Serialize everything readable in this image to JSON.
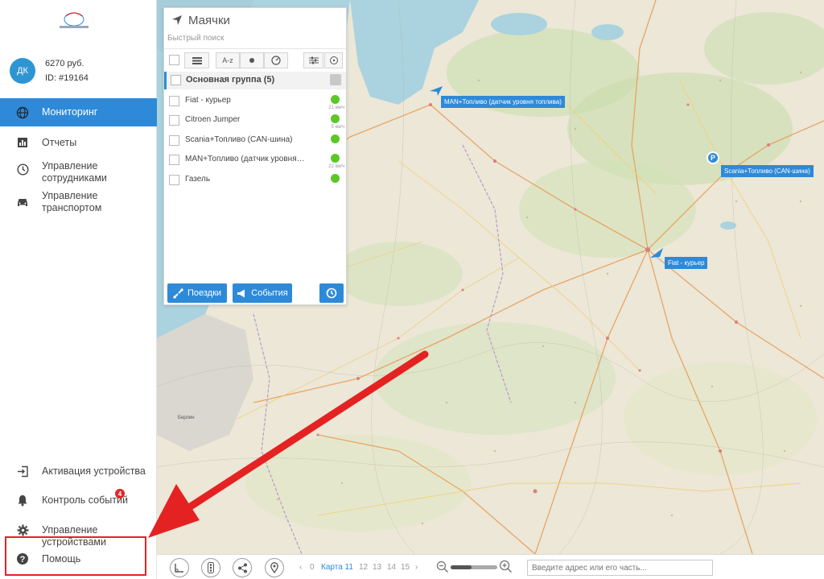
{
  "user": {
    "initials": "ДК",
    "balance": "6270 руб.",
    "id": "ID: #19164"
  },
  "nav": {
    "monitoring": "Мониторинг",
    "reports": "Отчеты",
    "staff_line1": "Управление",
    "staff_line2": "сотрудниками",
    "transport_line1": "Управление",
    "transport_line2": "транспортом",
    "activation": "Активация устройства",
    "events": "Контроль событий",
    "events_badge": "4",
    "devices": "Управление устройствами",
    "help": "Помощь"
  },
  "panel": {
    "title": "Маячки",
    "search_placeholder": "Быстрый поиск",
    "sort_az": "A-z",
    "group": "Основная группа (5)",
    "devices": [
      {
        "name": "Fiat - курьер",
        "speed": "21 км/ч"
      },
      {
        "name": "Citroen Jumper",
        "speed": "5 км/ч"
      },
      {
        "name": "Scania+Топливо (CAN-шина)",
        "speed": ""
      },
      {
        "name": "MAN+Топливо (датчик уровня т...",
        "speed": "22 км/ч"
      },
      {
        "name": "Газель",
        "speed": ""
      }
    ],
    "trips_button": "Поездки",
    "events_button": "События"
  },
  "map": {
    "label_man": "MAN+Топливо (датчик уровня топлива)",
    "label_scania": "Scania+Топливо (CAN-шина)",
    "label_fiat": "Fiat - курьер",
    "parking": "P",
    "city_label": "Берлин"
  },
  "bottom": {
    "prev": "‹",
    "z0": "0",
    "zcur": "Карта 11",
    "z12": "12",
    "z13": "13",
    "z14": "14",
    "z15": "15",
    "next": "›",
    "zoom_fraction": 0.45,
    "address_placeholder": "Введите адрес или его часть..."
  },
  "colors": {
    "accent": "#2e8ad8",
    "online": "#5cc726",
    "alert": "#e52222"
  }
}
